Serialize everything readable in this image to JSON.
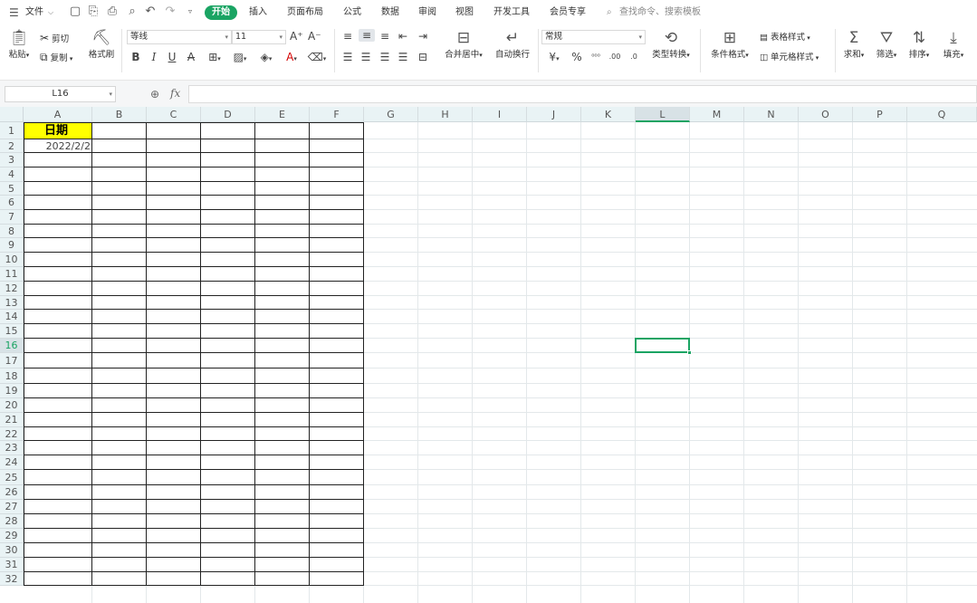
{
  "menubar": {
    "file": "文件",
    "tabs": [
      "开始",
      "插入",
      "页面布局",
      "公式",
      "数据",
      "审阅",
      "视图",
      "开发工具",
      "会员专享"
    ],
    "search_placeholder": "查找命令、搜索模板"
  },
  "ribbon": {
    "paste": "粘贴",
    "cut": "剪切",
    "copy": "复制",
    "format_painter": "格式刷",
    "font_name": "等线",
    "font_size": "11",
    "bold": "B",
    "italic": "I",
    "underline": "U",
    "strike": "A",
    "merge_center": "合并居中",
    "auto_wrap": "自动换行",
    "number_format": "常规",
    "currency": "¥",
    "percent": "%",
    "type_convert": "类型转换",
    "cond_format": "条件格式",
    "table_style": "表格样式",
    "cell_style": "单元格样式",
    "sum": "求和",
    "filter": "筛选",
    "sort": "排序",
    "fill": "填充"
  },
  "formula_bar": {
    "name_box": "L16",
    "fx": "fx",
    "value": ""
  },
  "sheet": {
    "columns": [
      "A",
      "B",
      "C",
      "D",
      "E",
      "F",
      "G",
      "H",
      "I",
      "J",
      "K",
      "L",
      "M",
      "N",
      "O",
      "P",
      "Q"
    ],
    "rows": [
      "1",
      "2",
      "3",
      "4",
      "5",
      "6",
      "7",
      "8",
      "9",
      "10",
      "11",
      "12",
      "13",
      "14",
      "15",
      "16",
      "17",
      "18",
      "19",
      "20",
      "21",
      "22",
      "23",
      "24",
      "25",
      "26",
      "27",
      "28",
      "29",
      "30",
      "31",
      "32"
    ],
    "selected_cell": "L16",
    "cells": {
      "A1": "日期",
      "A2": "2022/2/2"
    },
    "colors": {
      "header_fill": "#ffff00",
      "selection": "#1aa463"
    }
  }
}
